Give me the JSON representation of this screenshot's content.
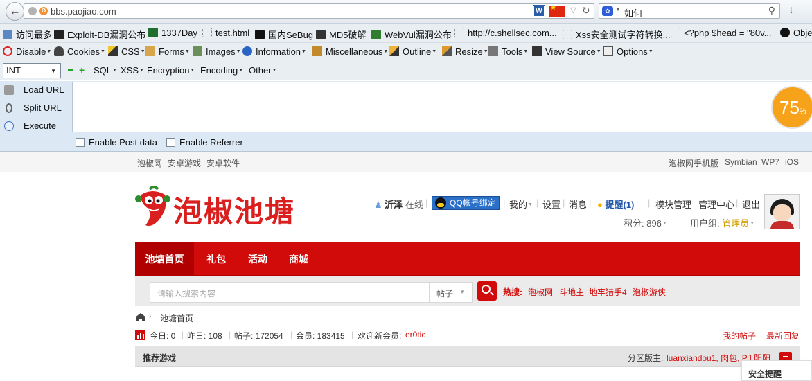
{
  "browser": {
    "url": "bbs.paojiao.com",
    "search_value": "如何",
    "bookmarks": [
      "访问最多",
      "Exploit-DB漏洞公布",
      "1337Day",
      "test.html",
      "国内SeBug",
      "MD5破解",
      "WebVul漏洞公布",
      "http://c.shellsec.com...",
      "Xss安全测试字符转换...",
      "<?php $head = \"80v...",
      "Obje"
    ],
    "hackbar_menu": [
      "Disable",
      "Cookies",
      "CSS",
      "Forms",
      "Images",
      "Information",
      "Miscellaneous",
      "Outline",
      "Resize",
      "Tools",
      "View Source",
      "Options"
    ],
    "hackbar_select": "INT",
    "hackbar_tools": [
      "SQL",
      "XSS",
      "Encryption",
      "Encoding",
      "Other"
    ],
    "hackbar_buttons": [
      "Load URL",
      "Split URL",
      "Execute"
    ],
    "enable_post": "Enable Post data",
    "enable_referrer": "Enable Referrer",
    "zoom_value": "75",
    "zoom_unit": "%"
  },
  "site": {
    "topnav_left": [
      "泡椒网",
      "安卓游戏",
      "安卓软件"
    ],
    "topnav_right": [
      "泡椒网手机版",
      "Symbian",
      "WP7",
      "iOS"
    ],
    "logo_text": "泡椒池塘",
    "user": {
      "name": "沂泽",
      "status": "在线",
      "qq_bind": "QQ帐号绑定",
      "mine": "我的",
      "settings": "设置",
      "messages": "消息",
      "reminder": "提醒(1)",
      "module_admin": "模块管理",
      "admin_center": "管理中心",
      "logout": "退出",
      "points_label": "积分: 896",
      "group_label": "用户组: ",
      "group_value": "管理员"
    },
    "main_tabs": [
      "池塘首页",
      "礼包",
      "活动",
      "商城"
    ],
    "search_placeholder": "请输入搜索内容",
    "search_type": "帖子",
    "hot_label": "热搜:",
    "hot_items": [
      "泡椒网",
      "斗地主",
      "地牢猎手4",
      "泡椒游侠"
    ],
    "breadcrumb": "池塘首页",
    "stats": {
      "today": "今日: 0",
      "yesterday": "昨日: 108",
      "posts": "帖子: 172054",
      "members": "会员: 183415",
      "welcome": "欢迎新会员: ",
      "new_member": "er0tic",
      "my_posts": "我的帖子",
      "latest": "最新回复"
    },
    "section": {
      "title": "推荐游戏",
      "mod_label": "分区版主: ",
      "mod_names": "luanxiandou1, 肉包, PJ.阳阳",
      "tip": "安全提醒"
    }
  },
  "colors": {
    "brand_red": "#d10a0a",
    "hackbar_bg": "#dce8f4"
  }
}
